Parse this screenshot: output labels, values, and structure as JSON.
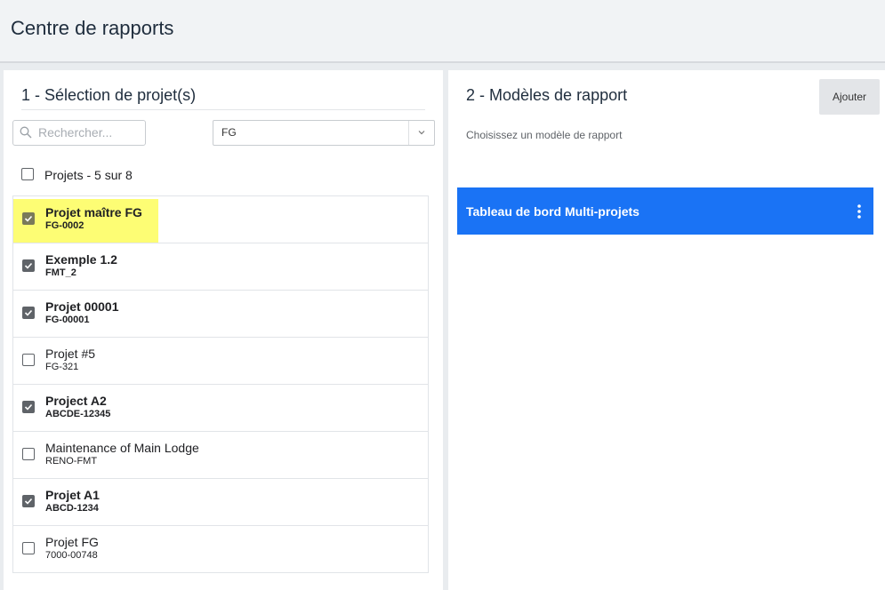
{
  "header": {
    "title": "Centre de rapports"
  },
  "project_selection": {
    "title": "1 - Sélection de projet(s)",
    "search": {
      "placeholder": "Rechercher...",
      "value": ""
    },
    "filter": {
      "value": "FG"
    },
    "select_all": {
      "label": "Projets - 5 sur 8",
      "checked": false
    },
    "projects": [
      {
        "name": "Projet maître FG",
        "code": "FG-0002",
        "checked": true,
        "highlighted": true
      },
      {
        "name": "Exemple 1.2",
        "code": "FMT_2",
        "checked": true
      },
      {
        "name": "Projet 00001",
        "code": "FG-00001",
        "checked": true
      },
      {
        "name": "Projet #5",
        "code": "FG-321",
        "checked": false
      },
      {
        "name": "Project A2",
        "code": "ABCDE-12345",
        "checked": true
      },
      {
        "name": "Maintenance of Main Lodge",
        "code": "RENO-FMT",
        "checked": false
      },
      {
        "name": "Projet A1",
        "code": "ABCD-1234",
        "checked": true
      },
      {
        "name": "Projet FG",
        "code": "7000-00748",
        "checked": false
      }
    ]
  },
  "report_templates": {
    "title": "2 - Modèles de rapport",
    "add_label": "Ajouter",
    "subtitle": "Choisissez un modèle de rapport",
    "items": [
      {
        "label": "Tableau de bord Multi-projets",
        "selected": true
      }
    ]
  },
  "colors": {
    "accent": "#1a73f5",
    "highlight": "#fdfd74",
    "checkbox": "#5f6368"
  },
  "icons": {
    "search": "search-icon",
    "dropdown": "chevron-down-icon",
    "menu": "kebab-menu-icon",
    "check": "check-icon"
  }
}
